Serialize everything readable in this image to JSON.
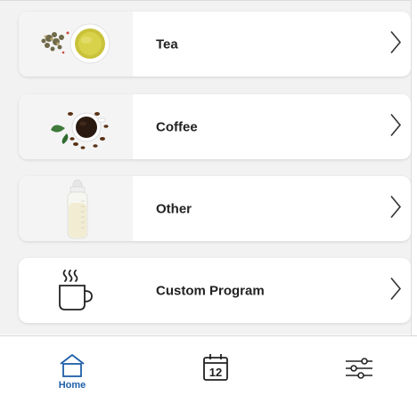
{
  "menu": {
    "items": [
      {
        "label": "Tea",
        "image": "tea-cup-image"
      },
      {
        "label": "Coffee",
        "image": "coffee-cup-image"
      },
      {
        "label": "Other",
        "image": "baby-bottle-image"
      },
      {
        "label": "Custom Program",
        "image": "steaming-cup-icon"
      }
    ]
  },
  "bottom_nav": {
    "home_label": "Home",
    "calendar_day": "12",
    "active": "home"
  },
  "colors": {
    "accent": "#1f5fa8",
    "background": "#f2f2f2",
    "card": "#ffffff"
  }
}
